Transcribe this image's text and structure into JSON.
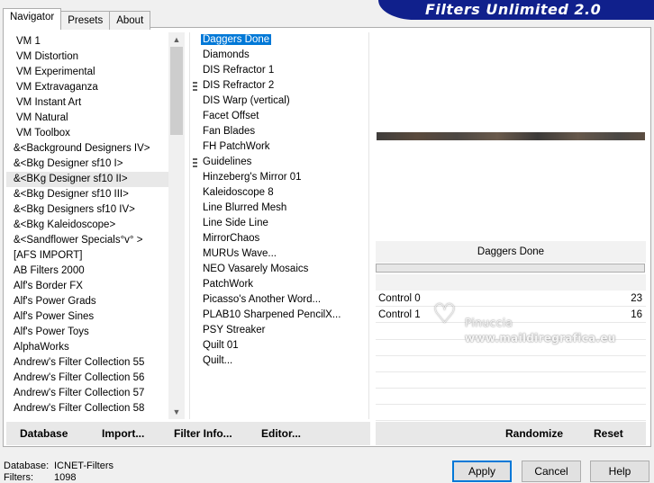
{
  "tabs": [
    {
      "label": "Navigator"
    },
    {
      "label": "Presets"
    },
    {
      "label": "About"
    }
  ],
  "banner": {
    "title": "Filters Unlimited 2.0"
  },
  "categories": [
    "VM 1",
    "VM Distortion",
    "VM Experimental",
    "VM Extravaganza",
    "VM Instant Art",
    "VM Natural",
    "VM Toolbox",
    "&<Background Designers IV>",
    "&<Bkg Designer sf10 I>",
    "&<BKg Designer sf10 II>",
    "&<Bkg Designer sf10 III>",
    "&<Bkg Designers sf10 IV>",
    "&<Bkg Kaleidoscope>",
    "&<Sandflower Specials°v° >",
    "[AFS IMPORT]",
    "AB Filters 2000",
    "Alf's Border FX",
    "Alf's Power Grads",
    "Alf's Power Sines",
    "Alf's Power Toys",
    "AlphaWorks",
    "Andrew's Filter Collection 55",
    "Andrew's Filter Collection 56",
    "Andrew's Filter Collection 57",
    "Andrew's Filter Collection 58"
  ],
  "selected_category": "&<BKg Designer sf10 II>",
  "filters": [
    "Daggers Done",
    "Diamonds",
    "DIS Refractor 1",
    "DIS Refractor 2",
    "DIS Warp (vertical)",
    "Facet Offset",
    "Fan Blades",
    "FH PatchWork",
    "Guidelines",
    "Hinzeberg's Mirror 01",
    "Kaleidoscope 8",
    "Line Blurred Mesh",
    "Line Side Line",
    "MirrorChaos",
    "MURUs Wave...",
    "NEO Vasarely Mosaics",
    "PatchWork",
    "Picasso's Another Word...",
    "PLAB10 Sharpened PencilX...",
    "PSY Streaker",
    "Quilt 01",
    "Quilt..."
  ],
  "selected_filter": "Daggers Done",
  "filter_name_display": "Daggers Done",
  "controls": [
    {
      "label": "Control 0",
      "value": "23"
    },
    {
      "label": "Control  1",
      "value": "16"
    }
  ],
  "watermark": {
    "name": "Pinuccia",
    "url": "www.maildiregrafica.eu"
  },
  "left_buttons": {
    "database": "Database",
    "import": "Import...",
    "filter_info": "Filter Info...",
    "editor": "Editor..."
  },
  "right_buttons": {
    "randomize": "Randomize",
    "reset": "Reset"
  },
  "status": {
    "database_label": "Database:",
    "database_value": "ICNET-Filters",
    "filters_label": "Filters:",
    "filters_value": "1098"
  },
  "dialog_buttons": {
    "apply": "Apply",
    "cancel": "Cancel",
    "help": "Help"
  },
  "colors": {
    "banner": "#10208c",
    "selection": "#0078d7"
  }
}
